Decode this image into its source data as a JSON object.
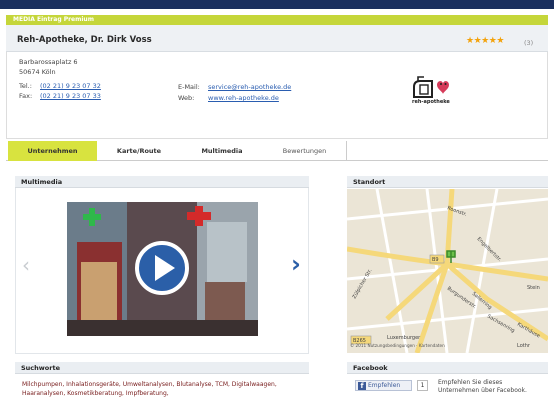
{
  "header": {
    "premium_label": "MEDIA Eintrag Premium"
  },
  "business": {
    "name": "Reh-Apotheke, Dr. Dirk Voss",
    "rating_stars": 5,
    "rating_count": "(3)",
    "street": "Barbarossaplatz 6",
    "city": "50674 Köln",
    "tel_label": "Tel.:",
    "tel": "(02 21) 9 23 07 32",
    "fax_label": "Fax:",
    "fax": "(02 21) 9 23 07 33",
    "email_label": "E-Mail:",
    "email": "service@reh-apotheke.de",
    "web_label": "Web:",
    "web": "www.reh-apotheke.de",
    "logo_text": "reh-apotheke"
  },
  "tabs": [
    {
      "label": "Unternehmen",
      "active": true
    },
    {
      "label": "Karte/Route",
      "active": false
    },
    {
      "label": "Multimedia",
      "active": false
    },
    {
      "label": "Bewertungen",
      "active": false
    }
  ],
  "multimedia": {
    "title": "Multimedia"
  },
  "suchworte": {
    "title": "Suchworte",
    "text": "Milchpumpen, Inhalationsgeräte, Umweltanalysen, Blutanalyse, TCM, Digitalwaagen, Haaranalysen, Kosmetikberatung, Impfberatung,"
  },
  "standort": {
    "title": "Standort",
    "map_labels": {
      "b9": "B9",
      "b265": "B265",
      "zuelpicher": "Zülpicher Str.",
      "burgunder": "Burgunderstr.",
      "salierring": "Salierring",
      "sachsenring": "Sachsenring",
      "karthaeuser": "Karthäuse",
      "luxemburger": "Luxemburger",
      "lothringer": "Lothr",
      "steinst": "Stein",
      "roonstr": "Roonstr.",
      "engelbert": "Engelbertstr."
    },
    "map_footer": "© 2011 Nutzungsbedingungen · Kartendaten"
  },
  "facebook": {
    "title": "Facebook",
    "button_label": "Empfehlen",
    "count": "1",
    "text": "Empfehlen Sie dieses Unternehmen über Facebook."
  },
  "colors": {
    "accent": "#c5d63a",
    "tab_active": "#d8e33f",
    "navy": "#1a2f5e",
    "link": "#2a5db0",
    "star": "#f3a20b",
    "play": "#2b5fa8"
  }
}
